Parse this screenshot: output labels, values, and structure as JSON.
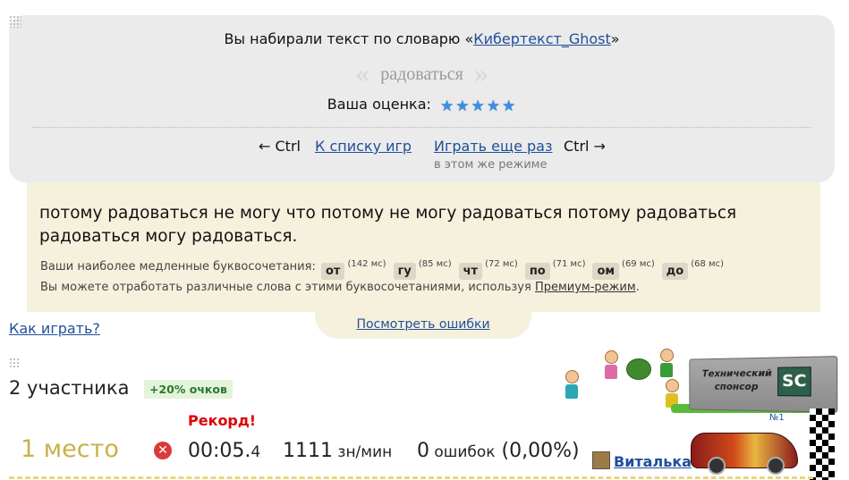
{
  "result_header": {
    "dict_prefix": "Вы набирали текст по словарю «",
    "dict_name": "Кибертекст_Ghost",
    "dict_suffix": "»",
    "word_quote_left": "«",
    "word": "радоваться",
    "word_quote_right": "»",
    "rating_label": "Ваша оценка:",
    "stars": [
      "★",
      "★",
      "★",
      "★",
      "★"
    ],
    "nav_back": "← Ctrl",
    "nav_list": "К списку игр",
    "nav_again": "Играть еще раз",
    "nav_forward": "Ctrl →",
    "nav_again_hint": "в этом же режиме"
  },
  "text_panel": {
    "typed_text": "потому радоваться не могу что потому не могу радоваться потому радоваться радоваться могу радоваться.",
    "slow_label": "Ваши наиболее медленные буквосочетания:",
    "slow_bigrams": [
      {
        "bg": "от",
        "ms": "(142 мс)"
      },
      {
        "bg": "гу",
        "ms": "(85 мс)"
      },
      {
        "bg": "чт",
        "ms": "(72 мс)"
      },
      {
        "bg": "по",
        "ms": "(71 мс)"
      },
      {
        "bg": "ом",
        "ms": "(69 мс)"
      },
      {
        "bg": "до",
        "ms": "(68 мс)"
      }
    ],
    "premium_prefix": "Вы можете отработать различные слова с этими буквосочетаниями, используя ",
    "premium_link": "Премиум-режим",
    "premium_suffix": "."
  },
  "errors_link": "Посмотреть ошибки",
  "how_to_play": "Как играть?",
  "participants": "2 участника",
  "bonus": "+20% очков",
  "sponsor": {
    "line1": "Технический",
    "line2": "спонсор",
    "logo": "SC"
  },
  "result_row": {
    "record": "Рекорд!",
    "place": "1 место",
    "error_icon": "✕",
    "time_main": "00:05.",
    "time_frac": "4",
    "speed_value": "1111",
    "speed_unit": " зн/мин",
    "errors_value": "0",
    "errors_unit": " ошибок",
    "errors_pct": " (0,00%)",
    "rank": "№1",
    "user": "Виталька"
  },
  "colors": {
    "link": "#1f4f9b",
    "record": "#dd0000",
    "place": "#c8b14b",
    "star": "#3a8fe0"
  }
}
